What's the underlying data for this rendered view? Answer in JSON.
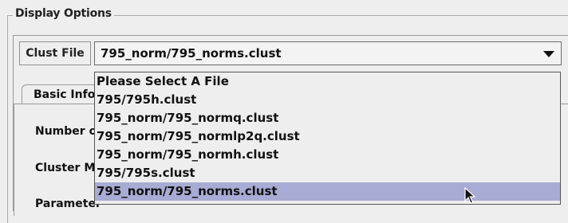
{
  "panel": {
    "title": "Display Options"
  },
  "clust_file": {
    "label": "Clust File",
    "selected_value": "795_norm/795_norms.clust",
    "options": [
      "Please Select A File",
      "795/795h.clust",
      "795_norm/795_normq.clust",
      "795_norm/795_normlp2q.clust",
      "795_norm/795_normh.clust",
      "795/795s.clust",
      "795_norm/795_norms.clust"
    ],
    "highlighted_index": 6
  },
  "tabs": {
    "basic_info_label": "Basic Info"
  },
  "rows": {
    "number_label": "Number of",
    "cluster_label": "Cluster M",
    "parameter_label": "Parameter"
  },
  "colors": {
    "highlight": "#a8abd4",
    "background": "#eeeeee"
  }
}
